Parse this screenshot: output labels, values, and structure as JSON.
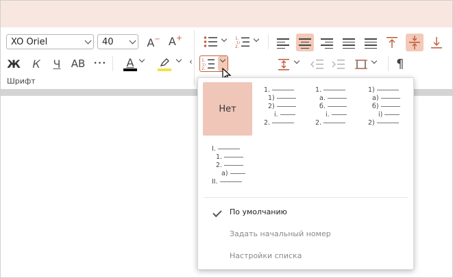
{
  "font": {
    "family_value": "XO Oriel",
    "size_value": "40",
    "decrease_label": "A",
    "increase_label": "A",
    "bold_label": "Ж",
    "italic_label": "К",
    "underline_label": "Ч",
    "caps_label": "АВ",
    "more_label": "•••",
    "font_color_label": "A",
    "group_label": "Шрифт"
  },
  "colors": {
    "accent": "#f3c9b8",
    "titlebar": "#f8e7e0",
    "font_color_swatch": "#000000",
    "highlight_swatch": "#f2e04a"
  },
  "paragraph": {
    "pilcrow": "¶"
  },
  "numbering_menu": {
    "none_label": "Нет",
    "presets": [
      {
        "rows": [
          "1.",
          "1)",
          "2)",
          "i.",
          "2."
        ]
      },
      {
        "rows": [
          "1.",
          "a.",
          "б.",
          "i.",
          "2."
        ]
      },
      {
        "rows": [
          "1)",
          "а)",
          "б)",
          "i)",
          "2)"
        ]
      },
      {
        "rows": [
          "I.",
          "1.",
          "2.",
          "а)",
          "II."
        ]
      }
    ],
    "default_label": "По умолчанию",
    "set_start_label": "Задать начальный номер",
    "list_settings_label": "Настройки списка"
  }
}
